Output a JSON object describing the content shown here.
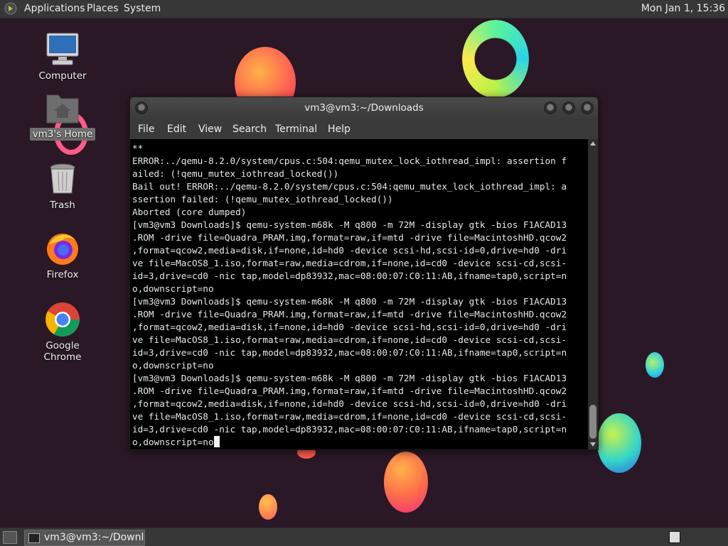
{
  "top_panel": {
    "menus": [
      "Applications",
      "Places",
      "System"
    ],
    "clock": "Mon Jan 1, 15:36"
  },
  "desktop": {
    "icons": [
      {
        "label": "Computer",
        "icon": "computer-icon"
      },
      {
        "label": "vm3's Home",
        "icon": "home-folder-icon"
      },
      {
        "label": "Trash",
        "icon": "trash-icon"
      },
      {
        "label": "Firefox",
        "icon": "firefox-icon"
      },
      {
        "label": "Google Chrome",
        "icon": "chrome-icon"
      }
    ]
  },
  "window": {
    "title": "vm3@vm3:~/Downloads",
    "menu": [
      "File",
      "Edit",
      "View",
      "Search",
      "Terminal",
      "Help"
    ],
    "terminal_lines": [
      "**",
      "ERROR:../qemu-8.2.0/system/cpus.c:504:qemu_mutex_lock_iothread_impl: assertion f",
      "ailed: (!qemu_mutex_iothread_locked())",
      "Bail out! ERROR:../qemu-8.2.0/system/cpus.c:504:qemu_mutex_lock_iothread_impl: a",
      "ssertion failed: (!qemu_mutex_iothread_locked())",
      "Aborted (core dumped)",
      "[vm3@vm3 Downloads]$ qemu-system-m68k -M q800 -m 72M -display gtk -bios F1ACAD13",
      ".ROM -drive file=Quadra_PRAM.img,format=raw,if=mtd -drive file=MacintoshHD.qcow2",
      ",format=qcow2,media=disk,if=none,id=hd0 -device scsi-hd,scsi-id=0,drive=hd0 -dri",
      "ve file=MacOS8_1.iso,format=raw,media=cdrom,if=none,id=cd0 -device scsi-cd,scsi-",
      "id=3,drive=cd0 -nic tap,model=dp83932,mac=08:00:07:C0:11:AB,ifname=tap0,script=n",
      "o,downscript=no",
      "[vm3@vm3 Downloads]$ qemu-system-m68k -M q800 -m 72M -display gtk -bios F1ACAD13",
      ".ROM -drive file=Quadra_PRAM.img,format=raw,if=mtd -drive file=MacintoshHD.qcow2",
      ",format=qcow2,media=disk,if=none,id=hd0 -device scsi-hd,scsi-id=0,drive=hd0 -dri",
      "ve file=MacOS8_1.iso,format=raw,media=cdrom,if=none,id=cd0 -device scsi-cd,scsi-",
      "id=3,drive=cd0 -nic tap,model=dp83932,mac=08:00:07:C0:11:AB,ifname=tap0,script=n",
      "o,downscript=no",
      "[vm3@vm3 Downloads]$ qemu-system-m68k -M q800 -m 72M -display gtk -bios F1ACAD13",
      ".ROM -drive file=Quadra_PRAM.img,format=raw,if=mtd -drive file=MacintoshHD.qcow2",
      ",format=qcow2,media=disk,if=none,id=hd0 -device scsi-hd,scsi-id=0,drive=hd0 -dri",
      "ve file=MacOS8_1.iso,format=raw,media=cdrom,if=none,id=cd0 -device scsi-cd,scsi-",
      "id=3,drive=cd0 -nic tap,model=dp83932,mac=08:00:07:C0:11:AB,ifname=tap0,script=n"
    ],
    "last_line": "o,downscript=no"
  },
  "taskbar": {
    "task_label": "vm3@vm3:~/Downl..."
  },
  "colors": {
    "background": "#2a1826",
    "panel": "#373737",
    "terminal_bg": "#000000",
    "terminal_fg": "#e8e8e8"
  }
}
